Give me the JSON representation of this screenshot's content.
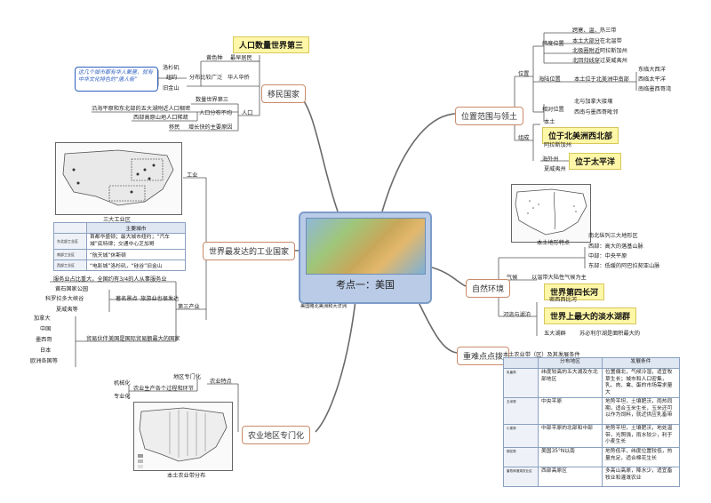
{
  "center": {
    "title": "考点一：美国",
    "caption": "美国略北美洲和大洋洲"
  },
  "branches": {
    "immigration": "移民国家",
    "industry": "世界最发达的工业国家",
    "agriculture": "农业地区专门化",
    "location": "位置范围与领土",
    "nature": "自然环境",
    "key": "重难点点拨"
  },
  "immigration": {
    "highlight": "人口数量世界第三",
    "yellow": "黄色种",
    "earliest": "最早居民",
    "la": "洛杉矶",
    "ny": "纽约",
    "sf": "旧金山",
    "dist": "分布比较广泛",
    "chinese": "华人华侨",
    "note": "这几个城市都有华人聚居，就有中华文化特色的“唐人街”",
    "third": "数量世界第三",
    "coast": "沿海平原和东北部的五大湖附近人口稠密",
    "west": "西部高原山地人口稀疏",
    "uneven": "人口分布不均",
    "pop": "人口",
    "migrant": "移民",
    "grow": "增长快的主要原因"
  },
  "industry": {
    "gong": "工业",
    "map_caption": "三大工业区",
    "cities_header": "主要城市",
    "cities": [
      "首都华盛顿；最大城市纽约；“汽车城”底特律；交通中心芝加哥",
      "“航天城”休斯顿",
      "“电影城”洛杉矶，“硅谷”旧金山"
    ],
    "row_labels": [
      "东北部工业区",
      "南部工业区",
      "西部工业区"
    ],
    "service": "服务业占比重大，全国约有3/4的人从事服务业",
    "parks": [
      "黄石国家公园",
      "科罗拉多大峡谷",
      "夏威夷等"
    ],
    "spots": "著名景点",
    "tourism": "旅游业也很发达",
    "tertiary": "第三产业",
    "partners": [
      "加拿大",
      "中国",
      "墨西哥",
      "日本",
      "欧洲各国等"
    ],
    "trade": "贸易伙伴",
    "trade_note": "美国是国际贸易额最大的国家"
  },
  "agriculture": {
    "specialize": "地区专门化",
    "mech": "机械化",
    "pro": "专业化",
    "process": "农业生产各个过程和环节",
    "feature": "农业特点",
    "map_caption": "本土农业带分布"
  },
  "location": {
    "weidu": "纬度位置",
    "zones": [
      "跨寒、温、热三带",
      "本土大部分在北温带",
      "北极圈附近阿拉斯加州",
      "北回归线穿过夏威夷州"
    ],
    "position": "位置",
    "haiyu": "海陆位置",
    "mainland": "本土位于北美洲中南部",
    "east": "东临大西洋",
    "west": "西临太平洋",
    "south": "南临墨西哥湾",
    "xiangdui": "相对位置",
    "near": [
      "北与加拿大接壤",
      "西南与墨西哥毗邻"
    ],
    "bentu": "本土",
    "hl1": "位于北美洲西北部",
    "alaska": "阿拉斯加州",
    "overseas": "海外州",
    "hl2": "位于太平洋",
    "hawaii": "夏威夷州",
    "composition": "组成"
  },
  "nature": {
    "landform": "本土地形特点",
    "terrain": [
      "南北纵列三大地形区",
      "西部：高大的落基山脉",
      "中部：中央平原",
      "东部：低缓的阿巴拉契亚山脉"
    ],
    "climate": "气候",
    "temperate": "以温带大陆性气候为主",
    "hl_river": "世界第四长河",
    "mississippi": "密西西比河",
    "hl_lake": "世界上最大的淡水湖群",
    "five_lakes": "五大湖群",
    "superior": "苏必利尔湖是面积最大的",
    "rivers": "河流与湖泊"
  },
  "key": {
    "title": "本土农业带（区）及其发展条件",
    "headers": [
      "分布地区",
      "发展条件"
    ],
    "rows": [
      {
        "label": "乳畜带",
        "region": "纬度较高的五大湖及东北部地区",
        "cond": "位置偏北，气候冷湿，适宜牧草生长；城市和人口密集，乳、肉、禽、蛋的市场需求量大"
      },
      {
        "label": "玉米带",
        "region": "中央平原",
        "cond": "地势平坦，土壤肥沃，雨热同期，适合玉米生长，玉米还可以作为饲料，就近供应乳畜带"
      },
      {
        "label": "小麦带",
        "region": "中部平原的北部和中部",
        "cond": "地势平坦，土壤肥沃，地处温带，光照强，雨水较少，利于小麦生长"
      },
      {
        "label": "棉花带",
        "region": "美国35°N以南",
        "cond": "地势低平，纬度位置较低，热量充足，适合棉花生长"
      },
      {
        "label": "畜牧和灌溉农业区",
        "region": "西部高原区",
        "cond": "多高山高原，降水少，适宜畜牧业和灌溉农业"
      }
    ]
  }
}
